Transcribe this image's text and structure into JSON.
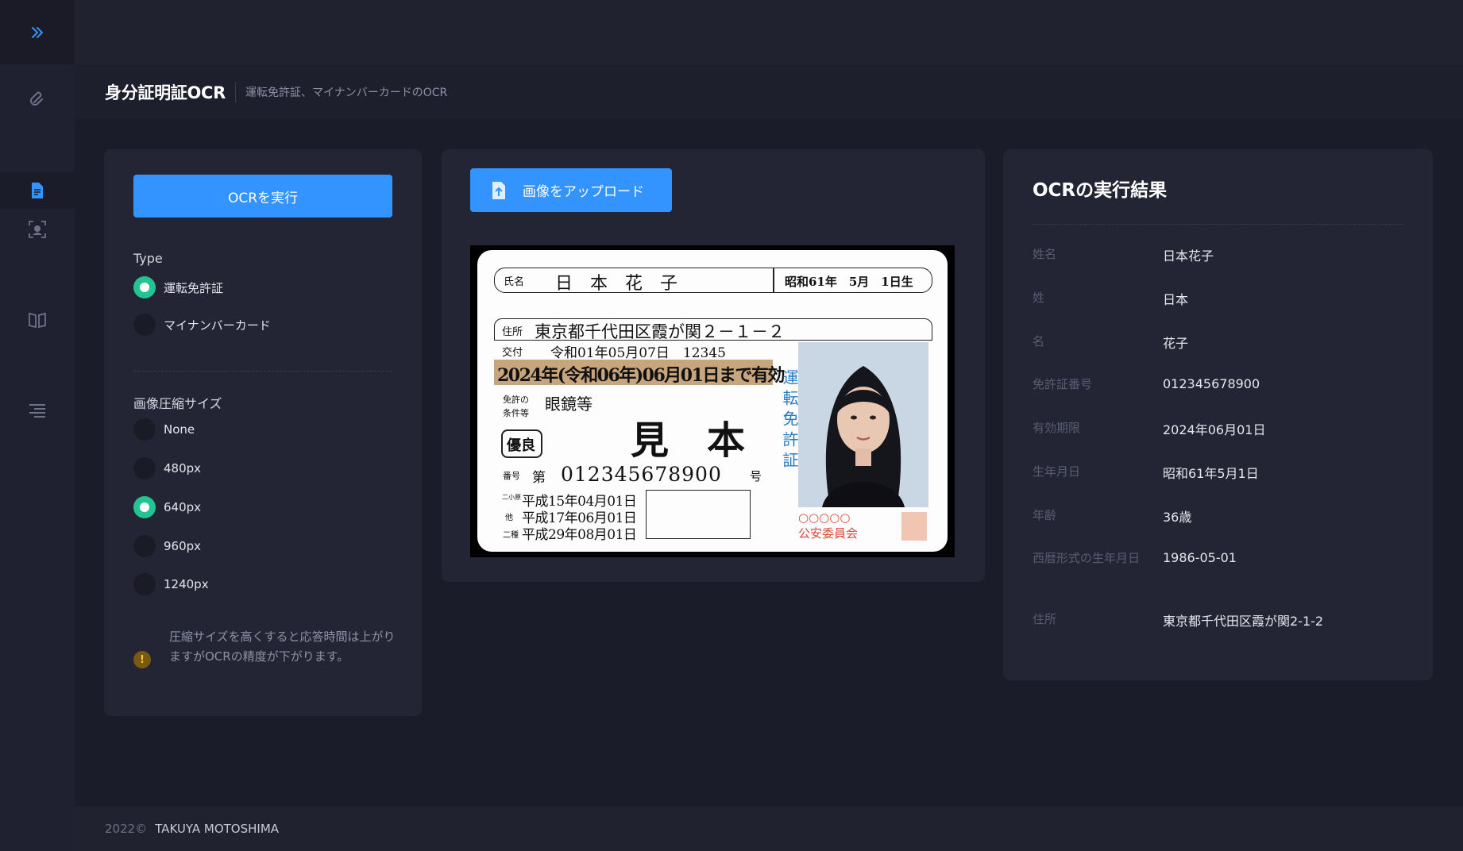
{
  "header": {
    "title": "身分証明証OCR",
    "subtitle": "運転免許証、マイナンバーカードのOCR"
  },
  "sidebar": {
    "items": [
      {
        "icon": "expand-icon"
      },
      {
        "icon": "paperclip-icon"
      },
      {
        "icon": "document-icon"
      },
      {
        "icon": "face-scan-icon"
      },
      {
        "icon": "book-icon"
      },
      {
        "icon": "menu-lines-icon"
      }
    ]
  },
  "controls": {
    "ocr_button": "OCRを実行",
    "type_label": "Type",
    "type_options": [
      "運転免許証",
      "マイナンバーカード"
    ],
    "type_selected": "運転免許証",
    "size_label": "画像圧縮サイズ",
    "size_options": [
      "None",
      "480px",
      "640px",
      "960px",
      "1240px"
    ],
    "size_selected": "640px",
    "notice": "圧縮サイズを高くすると応答時間は上がりますがOCRの精度が下がります。"
  },
  "upload": {
    "button": "画像をアップロード"
  },
  "license": {
    "name_label": "氏名",
    "name": "日　本　花　子",
    "birth": "昭和61年　5月　1日生",
    "address_label": "住所",
    "address": "東京都千代田区霞が関２－１－２",
    "issue_label": "交付",
    "issue": "令和01年05月07日　12345",
    "expiry": "2024年(令和06年)06月01日まで有効",
    "condition_label_1": "免許の",
    "condition_label_2": "条件等",
    "condition": "眼鏡等",
    "sample": "見　本",
    "badge": "優良",
    "number_label": "番号",
    "number_prefix": "第",
    "number": "012345678900",
    "number_suffix": "号",
    "vertical": "運転免許証",
    "dates": [
      "平成15年04月01日",
      "平成17年06月01日",
      "平成29年08月01日"
    ],
    "date_labels": [
      "二小原",
      "他",
      "二種"
    ],
    "seal_text": "○○○○○",
    "seal_sub": "公安委員会"
  },
  "results": {
    "title": "OCRの実行結果",
    "rows": [
      {
        "key": "姓名",
        "value": "日本花子"
      },
      {
        "key": "姓",
        "value": "日本"
      },
      {
        "key": "名",
        "value": "花子"
      },
      {
        "key": "免許証番号",
        "value": "012345678900"
      },
      {
        "key": "有効期限",
        "value": "2024年06月01日"
      },
      {
        "key": "生年月日",
        "value": "昭和61年5月1日"
      },
      {
        "key": "年齢",
        "value": "36歳"
      },
      {
        "key": "西暦形式の生年月日",
        "value": "1986-05-01"
      },
      {
        "key": "住所",
        "value": "東京都千代田区霞が関2-1-2"
      }
    ]
  },
  "footer": {
    "year": "2022©",
    "author": "TAKUYA MOTOSHIMA"
  },
  "colors": {
    "accent": "#3393ff",
    "radio_on": "#22c591",
    "background": "#1b1c29",
    "card": "#242534"
  }
}
